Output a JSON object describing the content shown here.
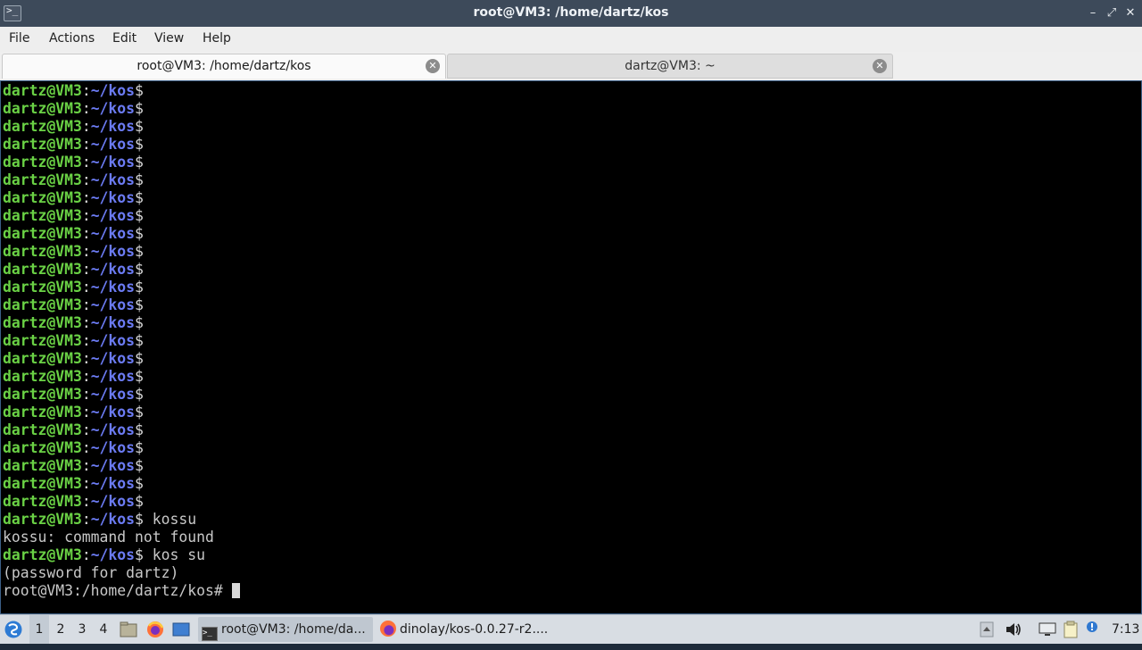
{
  "window": {
    "title": "root@VM3: /home/dartz/kos",
    "icon_glyph": ">_",
    "controls": {
      "minimize": "–",
      "maximize": "⤢",
      "close": "✕"
    }
  },
  "menu": [
    "File",
    "Actions",
    "Edit",
    "View",
    "Help"
  ],
  "tabs": [
    {
      "label": "root@VM3: /home/dartz/kos",
      "active": true
    },
    {
      "label": "dartz@VM3: ~",
      "active": false
    }
  ],
  "terminal": {
    "prompt_user": "dartz@VM3",
    "prompt_colon": ":",
    "prompt_path": "~/kos",
    "prompt_symbol": "$",
    "empty_prompt_count": 24,
    "history": [
      {
        "type": "prompt",
        "command": " kossu"
      },
      {
        "type": "output",
        "text": "kossu: command not found"
      },
      {
        "type": "prompt",
        "command": " kos su"
      },
      {
        "type": "output",
        "text": "(password for dartz)"
      }
    ],
    "root_prompt": "root@VM3:/home/dartz/kos# "
  },
  "taskbar": {
    "desktops": [
      "1",
      "2",
      "3",
      "4"
    ],
    "active_desktop": "1",
    "tasks": [
      {
        "label": "root@VM3: /home/da...",
        "icon": "terminal-icon",
        "active": true
      },
      {
        "label": "dinolay/kos-0.0.27-r2....",
        "icon": "firefox-icon",
        "active": false
      }
    ],
    "clock": "7:13"
  },
  "colors": {
    "prompt_user": "#6ad145",
    "prompt_path": "#6b7bf3",
    "terminal_bg": "#000000",
    "titlebar_bg": "#3d4a5a"
  }
}
